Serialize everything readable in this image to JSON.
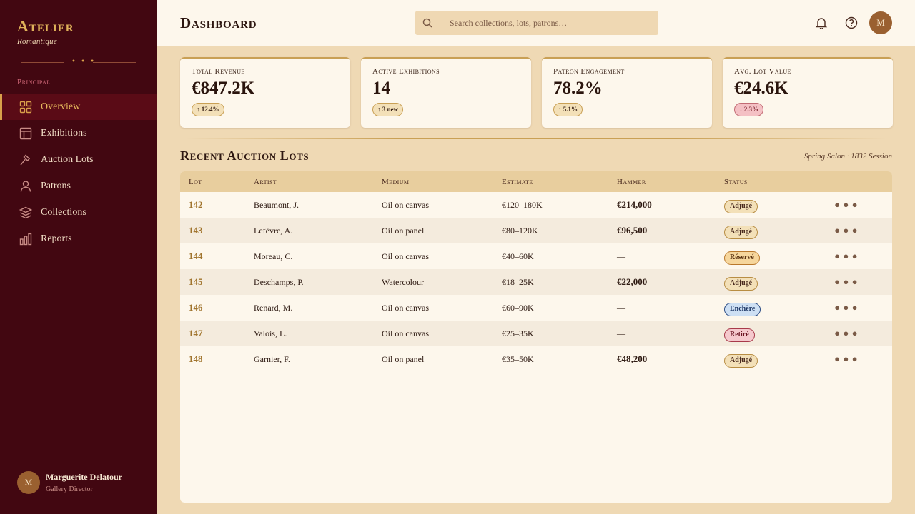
{
  "brand": {
    "name": "Atelier",
    "tagline": "Romantique"
  },
  "sidebar": {
    "section_label": "Principal",
    "items": [
      {
        "label": "Overview",
        "icon": "grid-icon",
        "active": true
      },
      {
        "label": "Exhibitions",
        "icon": "layout-icon",
        "active": false
      },
      {
        "label": "Auction Lots",
        "icon": "gavel-icon",
        "active": false
      },
      {
        "label": "Patrons",
        "icon": "user-icon",
        "active": false
      },
      {
        "label": "Collections",
        "icon": "layers-icon",
        "active": false
      },
      {
        "label": "Reports",
        "icon": "bar-chart-icon",
        "active": false
      }
    ],
    "user": {
      "initial": "M",
      "name": "Marguerite Delatour",
      "role": "Gallery Director"
    }
  },
  "header": {
    "title": "Dashboard",
    "search_placeholder": "Search collections, lots, patrons…",
    "avatar_initial": "M"
  },
  "stats": [
    {
      "label": "Total Revenue",
      "value": "€847.2K",
      "badge": "↑ 12.4%",
      "trend": "up"
    },
    {
      "label": "Active Exhibitions",
      "value": "14",
      "badge": "↑ 3 new",
      "trend": "up"
    },
    {
      "label": "Patron Engagement",
      "value": "78.2%",
      "badge": "↑ 5.1%",
      "trend": "up"
    },
    {
      "label": "Avg. Lot Value",
      "value": "€24.6K",
      "badge": "↓ 2.3%",
      "trend": "down"
    }
  ],
  "section": {
    "title": "Recent Auction Lots",
    "subtitle": "Spring Salon · 1832 Session"
  },
  "table": {
    "headers": {
      "lot": "Lot",
      "artist": "Artist",
      "medium": "Medium",
      "estimate": "Estimate",
      "hammer": "Hammer",
      "status": "Status"
    },
    "rows": [
      {
        "lot": "142",
        "artist": "Beaumont, J.",
        "medium": "Oil on canvas",
        "estimate": "€120–180K",
        "hammer": "€214,000",
        "status": "Adjugé",
        "status_kind": "sold"
      },
      {
        "lot": "143",
        "artist": "Lefèvre, A.",
        "medium": "Oil on panel",
        "estimate": "€80–120K",
        "hammer": "€96,500",
        "status": "Adjugé",
        "status_kind": "sold"
      },
      {
        "lot": "144",
        "artist": "Moreau, C.",
        "medium": "Oil on canvas",
        "estimate": "€40–60K",
        "hammer": "—",
        "status": "Réservé",
        "status_kind": "reserve"
      },
      {
        "lot": "145",
        "artist": "Deschamps, P.",
        "medium": "Watercolour",
        "estimate": "€18–25K",
        "hammer": "€22,000",
        "status": "Adjugé",
        "status_kind": "sold"
      },
      {
        "lot": "146",
        "artist": "Renard, M.",
        "medium": "Oil on canvas",
        "estimate": "€60–90K",
        "hammer": "—",
        "status": "Enchère",
        "status_kind": "bid"
      },
      {
        "lot": "147",
        "artist": "Valois, L.",
        "medium": "Oil on canvas",
        "estimate": "€25–35K",
        "hammer": "—",
        "status": "Retiré",
        "status_kind": "withdrawn"
      },
      {
        "lot": "148",
        "artist": "Garnier, F.",
        "medium": "Oil on panel",
        "estimate": "€35–50K",
        "hammer": "€48,200",
        "status": "Adjugé",
        "status_kind": "sold"
      }
    ],
    "more_label": "•••"
  },
  "colors": {
    "sidebar_bg": "#420711",
    "accent_gold": "#d9a04a",
    "page_bg": "#efd9b4",
    "card_bg": "#fdf7ec"
  }
}
